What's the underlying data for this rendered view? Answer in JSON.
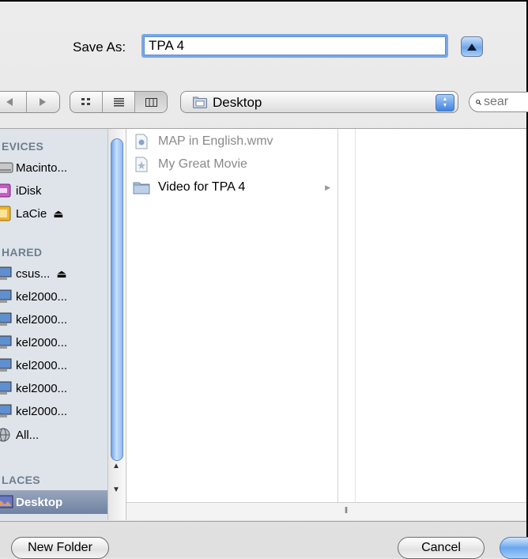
{
  "save_as": {
    "label": "Save As:",
    "value": "TPA 4"
  },
  "toolbar": {
    "nav": [
      "back",
      "forward"
    ],
    "views": [
      "icon-view",
      "list-view",
      "column-view"
    ],
    "location": "Desktop",
    "search_placeholder": "sear"
  },
  "sidebar": {
    "devices_header": "EVICES",
    "devices": [
      {
        "label": "Macinto...",
        "icon": "hard-drive-icon"
      },
      {
        "label": "iDisk",
        "icon": "idisk-icon"
      },
      {
        "label": "LaCie",
        "icon": "external-drive-icon",
        "eject": "⏏"
      }
    ],
    "shared_header": "HARED",
    "shared": [
      {
        "label": "csus...",
        "eject": "⏏"
      },
      {
        "label": "kel2000..."
      },
      {
        "label": "kel2000..."
      },
      {
        "label": "kel2000..."
      },
      {
        "label": "kel2000..."
      },
      {
        "label": "kel2000..."
      },
      {
        "label": "kel2000..."
      },
      {
        "label": "All...",
        "icon": "network-globe-icon"
      }
    ],
    "places_header": "LACES",
    "places": [
      {
        "label": "Desktop",
        "selected": true
      }
    ]
  },
  "files": [
    {
      "name": "MAP in English.wmv",
      "enabled": false,
      "icon": "movie-file-icon"
    },
    {
      "name": "My Great Movie",
      "enabled": false,
      "icon": "imovie-project-icon"
    },
    {
      "name": "Video for TPA 4",
      "enabled": true,
      "icon": "folder-icon",
      "has_children": true
    }
  ],
  "buttons": {
    "new_folder": "New Folder",
    "cancel": "Cancel"
  },
  "colors": {
    "accent": "#3f83e0",
    "sidebar_bg": "#dee4ea",
    "selection": "#7486a6"
  }
}
